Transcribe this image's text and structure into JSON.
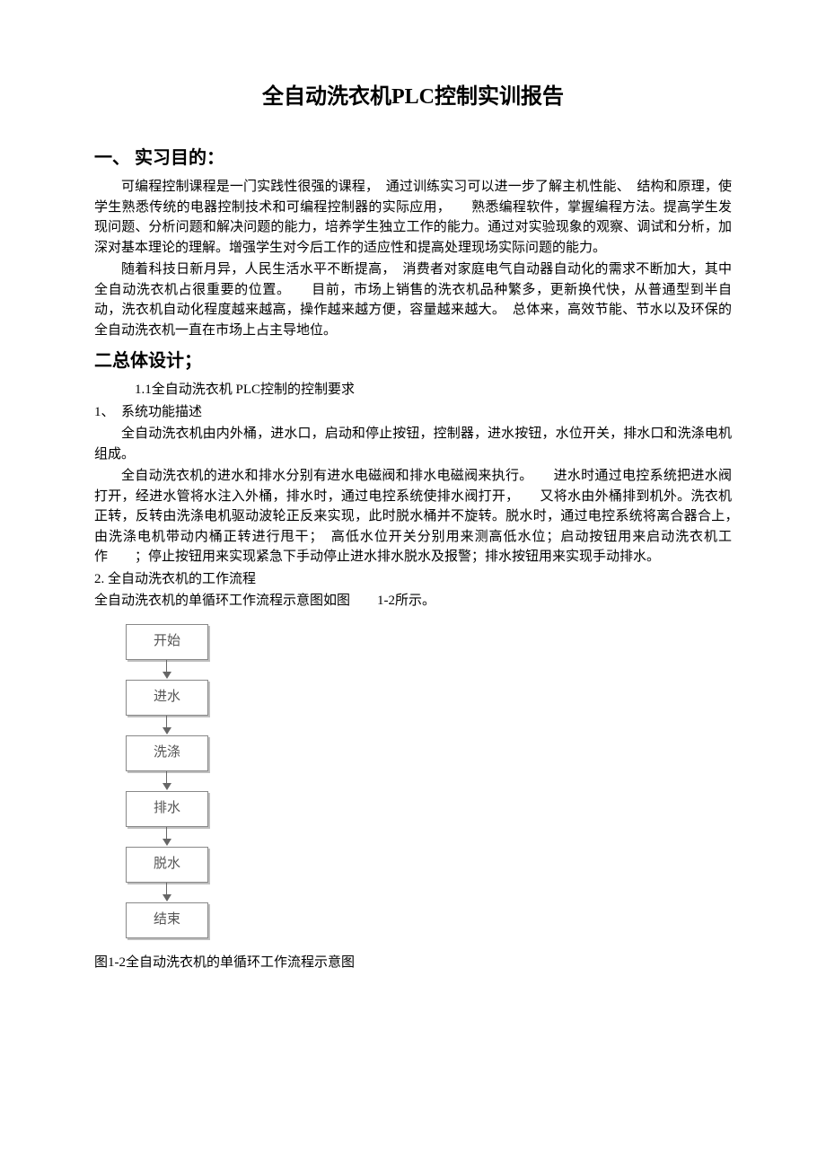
{
  "title": "全自动洗衣机PLC控制实训报告",
  "sections": {
    "s1": {
      "heading": "一、 实习目的：",
      "p1": "可编程控制课程是一门实践性很强的课程，　通过训练实习可以进一步了解主机性能、　结构和原理，使学生熟悉传统的电器控制技术和可编程控制器的实际应用，　　熟悉编程软件，掌握编程方法。提高学生发现问题、分析问题和解决问题的能力，培养学生独立工作的能力。通过对实验现象的观察、调试和分析，加深对基本理论的理解。增强学生对今后工作的适应性和提高处理现场实际问题的能力。",
      "p2": "随着科技日新月异，人民生活水平不断提高，　消费者对家庭电气自动器自动化的需求不断加大，其中全自动洗衣机占很重要的位置。　　目前，市场上销售的洗衣机品种繁多，更新换代快，从普通型到半自动，洗衣机自动化程度越来越高，操作越来越方便，容量越来越大。　总体来，高效节能、节水以及环保的全自动洗衣机一直在市场上占主导地位。"
    },
    "s2": {
      "heading": "二总体设计；",
      "sub1": "1.1全自动洗衣机 PLC控制的控制要求",
      "item1_label": "1、　系统功能描述",
      "item1_p1": "全自动洗衣机由内外桶，进水口，启动和停止按钮，控制器，进水按钮，水位开关，排水口和洗涤电机组成。",
      "item1_p2": "全自动洗衣机的进水和排水分别有进水电磁阀和排水电磁阀来执行。　　进水时通过电控系统把进水阀打开，经进水管将水注入外桶，排水时，通过电控系统使排水阀打开，　　又将水由外桶排到机外。洗衣机正转，反转由洗涤电机驱动波轮正反来实现，此时脱水桶并不旋转。脱水时，通过电控系统将离合器合上，　　由洗涤电机带动内桶正转进行甩干；　高低水位开关分别用来测高低水位；启动按钮用来启动洗衣机工作　　；停止按钮用来实现紧急下手动停止进水排水脱水及报警；排水按钮用来实现手动排水。",
      "item2_label": "2. 全自动洗衣机的工作流程",
      "item2_p1": "全自动洗衣机的单循环工作流程示意图如图　　1-2所示。"
    }
  },
  "flowchart": {
    "steps": [
      "开始",
      "进水",
      "洗涤",
      "排水",
      "脱水",
      "结束"
    ]
  },
  "figure_caption": "图1-2全自动洗衣机的单循环工作流程示意图"
}
